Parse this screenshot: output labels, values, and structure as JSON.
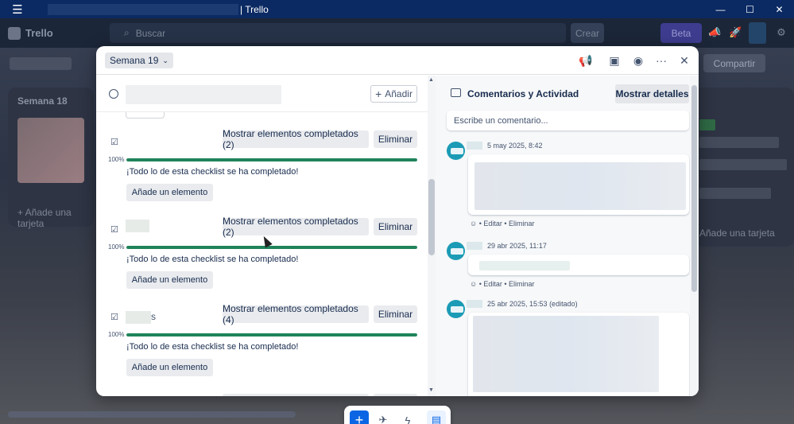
{
  "window": {
    "title": "| Trello",
    "controls": [
      "minimize-icon",
      "maximize-icon",
      "close-icon"
    ]
  },
  "topbar": {
    "logo": "Trello",
    "search_placeholder": "Buscar",
    "create": "Crear",
    "beta": "Beta"
  },
  "board": {
    "share": "Compartir",
    "list1_title": "Semana 18",
    "add_card": "+ Añade una tarjeta",
    "add_card_right": "Añade una tarjeta"
  },
  "modal": {
    "list_selector": "Semana 19",
    "add_button": "Añadir",
    "checklists": [
      {
        "name": "",
        "show_completed": "Mostrar elementos completados (2)",
        "delete": "Eliminar",
        "percent": "100%",
        "progress": 1.0,
        "done_text": "¡Todo lo de esta checklist se ha completado!",
        "add_item": "Añade un elemento"
      },
      {
        "name": "",
        "show_completed": "Mostrar elementos completados (2)",
        "delete": "Eliminar",
        "percent": "100%",
        "progress": 1.0,
        "done_text": "¡Todo lo de esta checklist se ha completado!",
        "add_item": "Añade un elemento"
      },
      {
        "name": "s",
        "show_completed": "Mostrar elementos completados (4)",
        "delete": "Eliminar",
        "percent": "100%",
        "progress": 1.0,
        "done_text": "¡Todo lo de esta checklist se ha completado!",
        "add_item": "Añade un elemento"
      }
    ],
    "activity": {
      "title": "Comentarios y Actividad",
      "show_details": "Mostrar detalles",
      "comment_placeholder": "Escribe un comentario...",
      "comments": [
        {
          "timestamp": "5 may 2025, 8:42",
          "edit": "Editar",
          "delete": "Eliminar"
        },
        {
          "timestamp": "29 abr 2025, 11:17",
          "edit": "Editar",
          "delete": "Eliminar"
        },
        {
          "timestamp": "25 abr 2025, 15:53 (editado)"
        }
      ]
    }
  },
  "colors": {
    "progress": "#1f845a",
    "primary": "#0c66e4",
    "titlebar": "#0b2a63"
  }
}
